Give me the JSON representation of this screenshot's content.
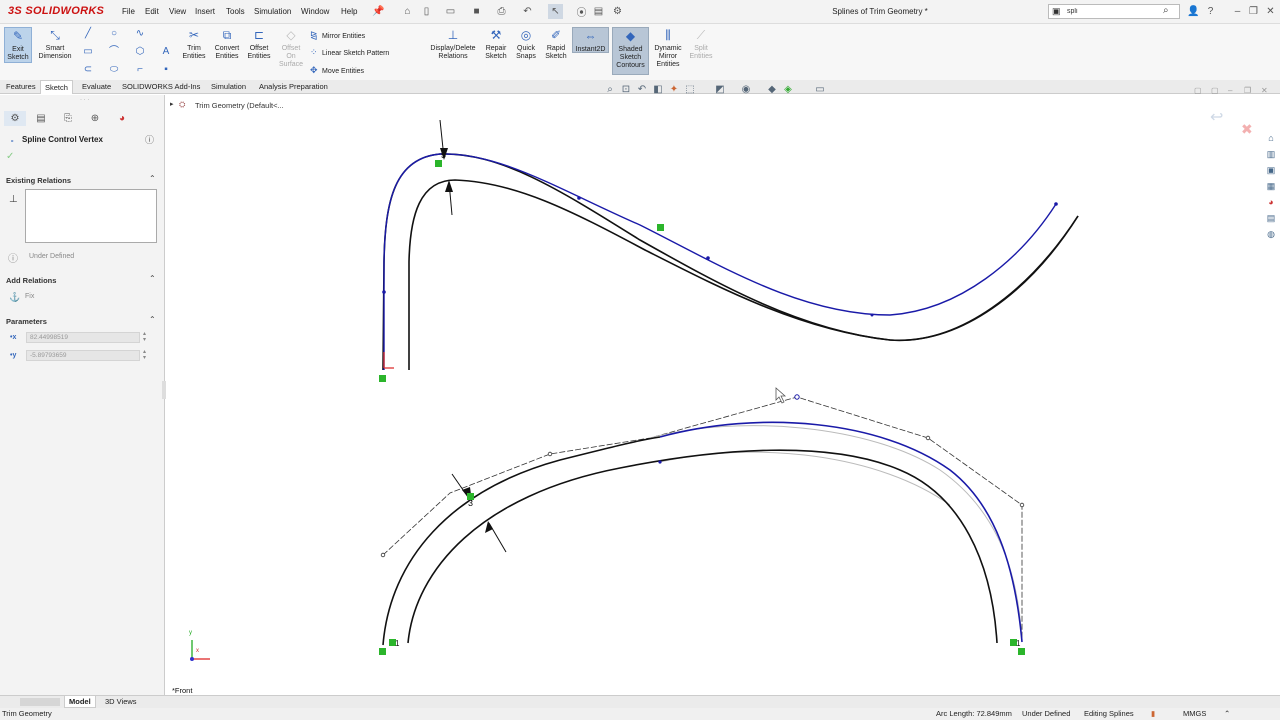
{
  "app": {
    "logo_text": "SOLIDWORKS",
    "document_title": "Splines of Trim Geometry *"
  },
  "menu": [
    "File",
    "Edit",
    "View",
    "Insert",
    "Tools",
    "Simulation",
    "Window",
    "Help"
  ],
  "search": {
    "value": "spli"
  },
  "command_manager": {
    "exit_sketch": "Exit Sketch",
    "smart_dimension": "Smart Dimension",
    "trim_entities": "Trim Entities",
    "convert_entities": "Convert Entities",
    "offset_entities": "Offset Entities",
    "offset_on_surface": "Offset On Surface",
    "mirror_entities": "Mirror Entities",
    "linear_sketch_pattern": "Linear Sketch Pattern",
    "move_entities": "Move Entities",
    "display_delete_relations": "Display/Delete Relations",
    "repair_sketch": "Repair Sketch",
    "quick_snaps": "Quick Snaps",
    "rapid_sketch": "Rapid Sketch",
    "instant2d": "Instant2D",
    "shaded_sketch_contours": "Shaded Sketch Contours",
    "dynamic_mirror_entities": "Dynamic Mirror Entities",
    "split_entities": "Split Entities"
  },
  "tabs": [
    "Features",
    "Sketch",
    "Evaluate",
    "SOLIDWORKS Add-Ins",
    "Simulation",
    "Analysis Preparation"
  ],
  "property_manager": {
    "title": "Spline Control Vertex",
    "existing_relations": "Existing Relations",
    "status": "Under Defined",
    "add_relations": "Add Relations",
    "fix": "Fix",
    "parameters": "Parameters",
    "x_value": "82.44998519",
    "y_value": "-5.89793659"
  },
  "feature_tree": {
    "root": "Trim Geometry  (Default<..."
  },
  "graphics": {
    "view_label": "*Front",
    "axis_x": "x",
    "axis_y": "y",
    "marker_5": "5",
    "marker_3": "3",
    "marker_1": "1"
  },
  "bottom_tabs": [
    "Model",
    "3D Views"
  ],
  "status_bar": {
    "left": "Trim Geometry",
    "arc_length": "Arc Length: 72.849mm",
    "definition": "Under Defined",
    "mode": "Editing Splines",
    "units": "MMGS"
  },
  "colors": {
    "spline_selected": "#1a1aa8",
    "spline": "#111111",
    "relation_green": "#2bb52b",
    "ghost": "#bbbbbb"
  }
}
